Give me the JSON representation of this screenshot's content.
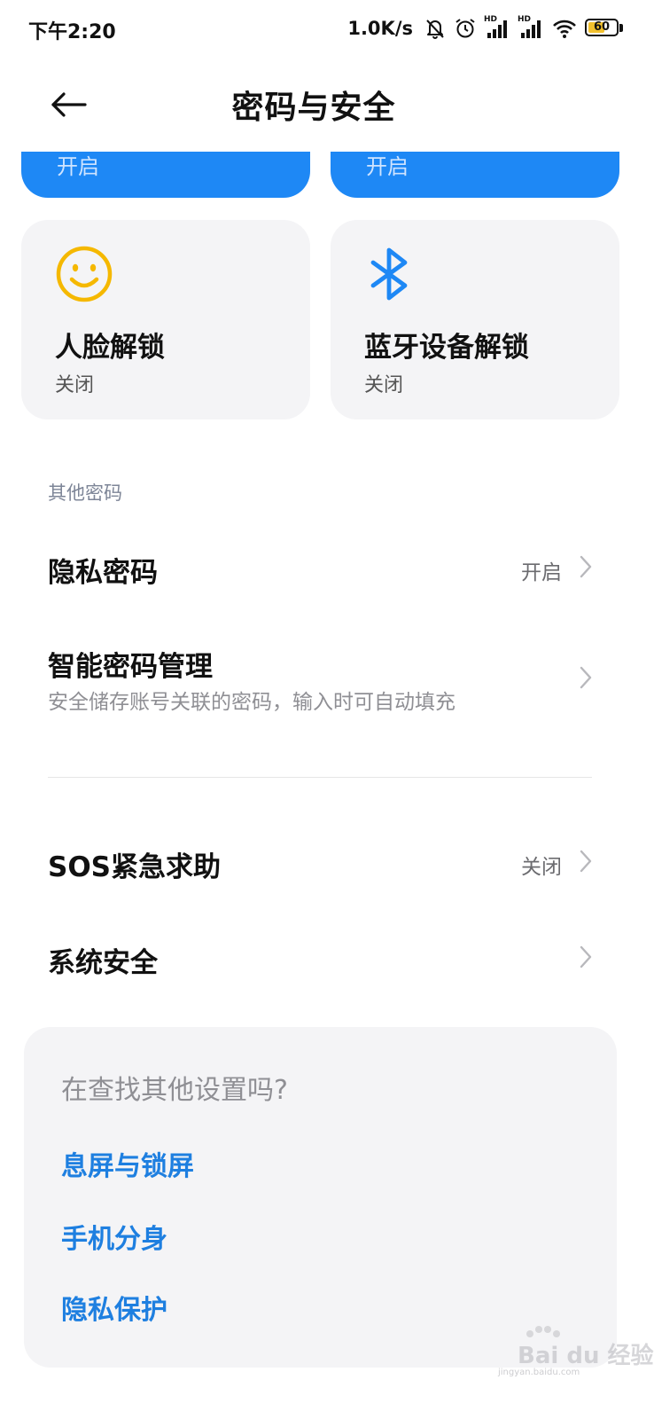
{
  "status_bar": {
    "time": "下午2:20",
    "net_speed": "1.0K/s",
    "icons": [
      "bell-muted-icon",
      "alarm-icon",
      "signal-hd-icon",
      "signal-hd-icon",
      "wifi-icon",
      "battery-icon"
    ],
    "signal_badge_1": "HD",
    "signal_badge_2": "HD",
    "battery_level": "60",
    "battery_fraction": 0.6,
    "battery_color": "#f2c12e"
  },
  "header": {
    "title": "密码与安全",
    "back_icon": "arrow-left-icon"
  },
  "top_cards": [
    {
      "status": "开启"
    },
    {
      "status": "开启"
    }
  ],
  "unlock_cards": [
    {
      "icon": "smiley-face-icon",
      "title": "人脸解锁",
      "status": "关闭",
      "icon_color": "#f5b800"
    },
    {
      "icon": "bluetooth-icon",
      "title": "蓝牙设备解锁",
      "status": "关闭",
      "icon_color": "#1e88f5"
    }
  ],
  "other_passwords": {
    "section_label": "其他密码",
    "privacy_password": {
      "title": "隐私密码",
      "value": "开启"
    },
    "smart_password": {
      "title": "智能密码管理",
      "subtitle": "安全储存账号关联的密码，输入时可自动填充"
    }
  },
  "more_rows": {
    "sos": {
      "title": "SOS紧急求助",
      "value": "关闭"
    },
    "system_security": {
      "title": "系统安全"
    }
  },
  "suggestions": {
    "title": "在查找其他设置吗?",
    "links": [
      "息屏与锁屏",
      "手机分身",
      "隐私保护"
    ]
  },
  "watermark": {
    "text": "Bai du 经验",
    "sub": "jingyan.baidu.com"
  },
  "colors": {
    "accent_blue": "#1e88f5",
    "link_blue": "#1e7fe0",
    "card_gray": "#f4f4f6"
  }
}
